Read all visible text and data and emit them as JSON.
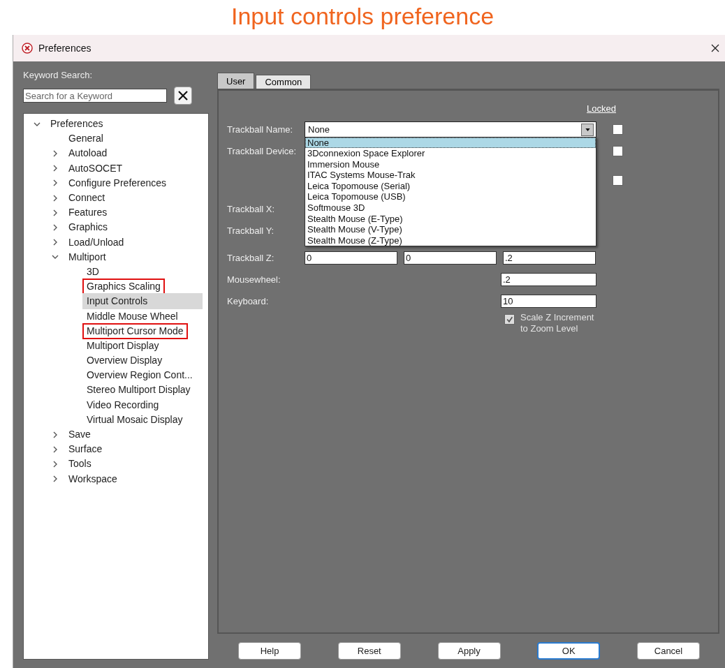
{
  "heading": "Input controls preference",
  "window": {
    "title": "Preferences"
  },
  "keyword_search": {
    "label": "Keyword Search:",
    "placeholder": "Search for a Keyword"
  },
  "tree": {
    "items": [
      {
        "label": "Preferences",
        "expanded": true,
        "selected": false,
        "children": [
          {
            "label": "General",
            "selected": false
          },
          {
            "label": "Autoload",
            "expanded": false,
            "selected": false
          },
          {
            "label": "AutoSOCET",
            "expanded": false,
            "selected": false
          },
          {
            "label": "Configure Preferences",
            "expanded": false,
            "selected": false
          },
          {
            "label": "Connect",
            "expanded": false,
            "selected": false
          },
          {
            "label": "Features",
            "expanded": false,
            "selected": false
          },
          {
            "label": "Graphics",
            "expanded": false,
            "selected": false
          },
          {
            "label": "Load/Unload",
            "expanded": false,
            "selected": false
          },
          {
            "label": "Multiport",
            "expanded": true,
            "selected": false,
            "children": [
              {
                "label": "3D",
                "selected": false,
                "highlighted": false
              },
              {
                "label": "Graphics Scaling",
                "selected": false,
                "highlighted": true
              },
              {
                "label": "Input Controls",
                "selected": true,
                "highlighted": false
              },
              {
                "label": "Middle Mouse Wheel",
                "selected": false,
                "highlighted": false
              },
              {
                "label": "Multiport Cursor Mode",
                "selected": false,
                "highlighted": true
              },
              {
                "label": "Multiport Display",
                "selected": false,
                "highlighted": false
              },
              {
                "label": "Overview Display",
                "selected": false,
                "highlighted": false
              },
              {
                "label": "Overview Region Cont...",
                "selected": false,
                "highlighted": false
              },
              {
                "label": "Stereo Multiport Display",
                "selected": false,
                "highlighted": false
              },
              {
                "label": "Video Recording",
                "selected": false,
                "highlighted": false
              },
              {
                "label": "Virtual Mosaic Display",
                "selected": false,
                "highlighted": false
              }
            ]
          },
          {
            "label": "Save",
            "expanded": false,
            "selected": false
          },
          {
            "label": "Surface",
            "expanded": false,
            "selected": false
          },
          {
            "label": "Tools",
            "expanded": false,
            "selected": false
          },
          {
            "label": "Workspace",
            "expanded": false,
            "selected": false
          }
        ]
      }
    ]
  },
  "tabs": [
    {
      "label": "User",
      "selected": true
    },
    {
      "label": "Common",
      "selected": false
    }
  ],
  "form": {
    "locked_header": "Locked",
    "rows": [
      {
        "kind": "combo",
        "label": "Trackball Name:",
        "value": "None",
        "locked": false
      },
      {
        "kind": "blank",
        "label": "Trackball Device:",
        "locked": false
      },
      {
        "kind": "blank",
        "locked": false
      },
      {
        "kind": "blank",
        "label": "Trackball X:"
      },
      {
        "kind": "blank",
        "label": "Trackball Y:"
      },
      {
        "kind": "triple",
        "label": "Trackball Z:",
        "values": [
          "0",
          "0",
          ".2"
        ]
      },
      {
        "kind": "single",
        "label": "Mousewheel:",
        "value": ".2"
      },
      {
        "kind": "single",
        "label": "Keyboard:",
        "value": "10"
      },
      {
        "kind": "checkbox",
        "label": "Scale Z Increment to Zoom Level",
        "checked": true,
        "disabled": true
      }
    ]
  },
  "dropdown": {
    "options": [
      {
        "label": "None",
        "selected": true
      },
      {
        "label": "3Dconnexion Space Explorer",
        "selected": false
      },
      {
        "label": "Immersion Mouse",
        "selected": false
      },
      {
        "label": "ITAC Systems Mouse-Trak",
        "selected": false
      },
      {
        "label": "Leica Topomouse (Serial)",
        "selected": false
      },
      {
        "label": "Leica Topomouse (USB)",
        "selected": false
      },
      {
        "label": "Softmouse 3D",
        "selected": false
      },
      {
        "label": "Stealth Mouse (E-Type)",
        "selected": false
      },
      {
        "label": "Stealth Mouse (V-Type)",
        "selected": false
      },
      {
        "label": "Stealth Mouse (Z-Type)",
        "selected": false
      }
    ]
  },
  "buttons": [
    {
      "label": "Help",
      "default": false
    },
    {
      "label": "Reset",
      "default": false
    },
    {
      "label": "Apply",
      "default": false
    },
    {
      "label": "OK",
      "default": true
    },
    {
      "label": "Cancel",
      "default": false
    }
  ]
}
